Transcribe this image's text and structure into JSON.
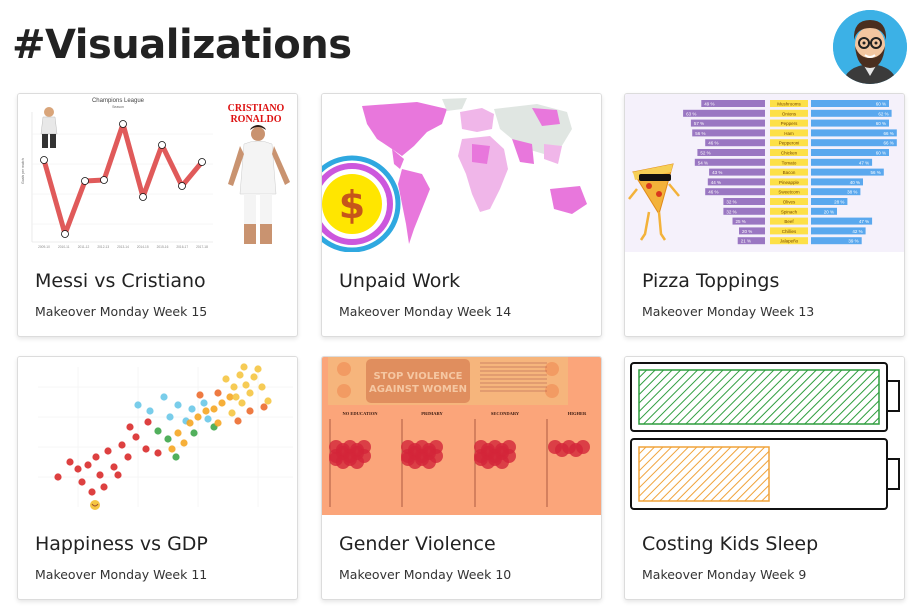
{
  "header": {
    "title": "#Visualizations",
    "avatar_icon": "bearded-man-avatar-icon"
  },
  "cards": [
    {
      "title": "Messi vs Cristiano",
      "subtitle": "Makeover Monday Week 15",
      "thumb": {
        "chart_title": "Champions League",
        "chart_sub": "Season",
        "ylabel": "Goals per match",
        "banner": [
          "CRISTIANO",
          "RONALDO"
        ],
        "ticks": [
          "2009-10",
          "2010-11",
          "2011-12",
          "2012-13",
          "2013-14",
          "2014-15",
          "2015-16",
          "2016-17",
          "2017-18"
        ]
      }
    },
    {
      "title": "Unpaid Work",
      "subtitle": "Makeover Monday Week 14",
      "thumb": {
        "symbol": "$"
      }
    },
    {
      "title": "Pizza Toppings",
      "subtitle": "Makeover Monday Week 13",
      "thumb": {
        "rows": [
          {
            "left": "49 %",
            "name": "Mushrooms",
            "right": "60 %"
          },
          {
            "left": "63 %",
            "name": "Onions",
            "right": "62 %"
          },
          {
            "left": "57 %",
            "name": "Peppers",
            "right": "60 %"
          },
          {
            "left": "56 %",
            "name": "Ham",
            "right": "66 %"
          },
          {
            "left": "46 %",
            "name": "Pepperoni",
            "right": "66 %"
          },
          {
            "left": "52 %",
            "name": "Chicken",
            "right": "60 %"
          },
          {
            "left": "54 %",
            "name": "Tomato",
            "right": "47 %"
          },
          {
            "left": "43 %",
            "name": "Bacon",
            "right": "56 %"
          },
          {
            "left": "44 %",
            "name": "Pineapple",
            "right": "40 %"
          },
          {
            "left": "46 %",
            "name": "Sweetcorn",
            "right": "38 %"
          },
          {
            "left": "32 %",
            "name": "Olives",
            "right": "28 %"
          },
          {
            "left": "32 %",
            "name": "Spinach",
            "right": "20 %"
          },
          {
            "left": "25 %",
            "name": "Beef",
            "right": "47 %"
          },
          {
            "left": "20 %",
            "name": "Chillies",
            "right": "42 %"
          },
          {
            "left": "21 %",
            "name": "Jalapeño",
            "right": "39 %"
          }
        ]
      }
    },
    {
      "title": "Happiness vs GDP",
      "subtitle": "Makeover Monday Week 11",
      "thumb": {}
    },
    {
      "title": "Gender Violence",
      "subtitle": "Makeover Monday Week 10",
      "thumb": {
        "banner": [
          "STOP VIOLENCE",
          "AGAINST WOMEN"
        ],
        "columns": [
          "NO EDUCATION",
          "PRIMARY",
          "SECONDARY",
          "HIGHER"
        ]
      }
    },
    {
      "title": "Costing Kids Sleep",
      "subtitle": "Makeover Monday Week 9",
      "thumb": {}
    }
  ]
}
